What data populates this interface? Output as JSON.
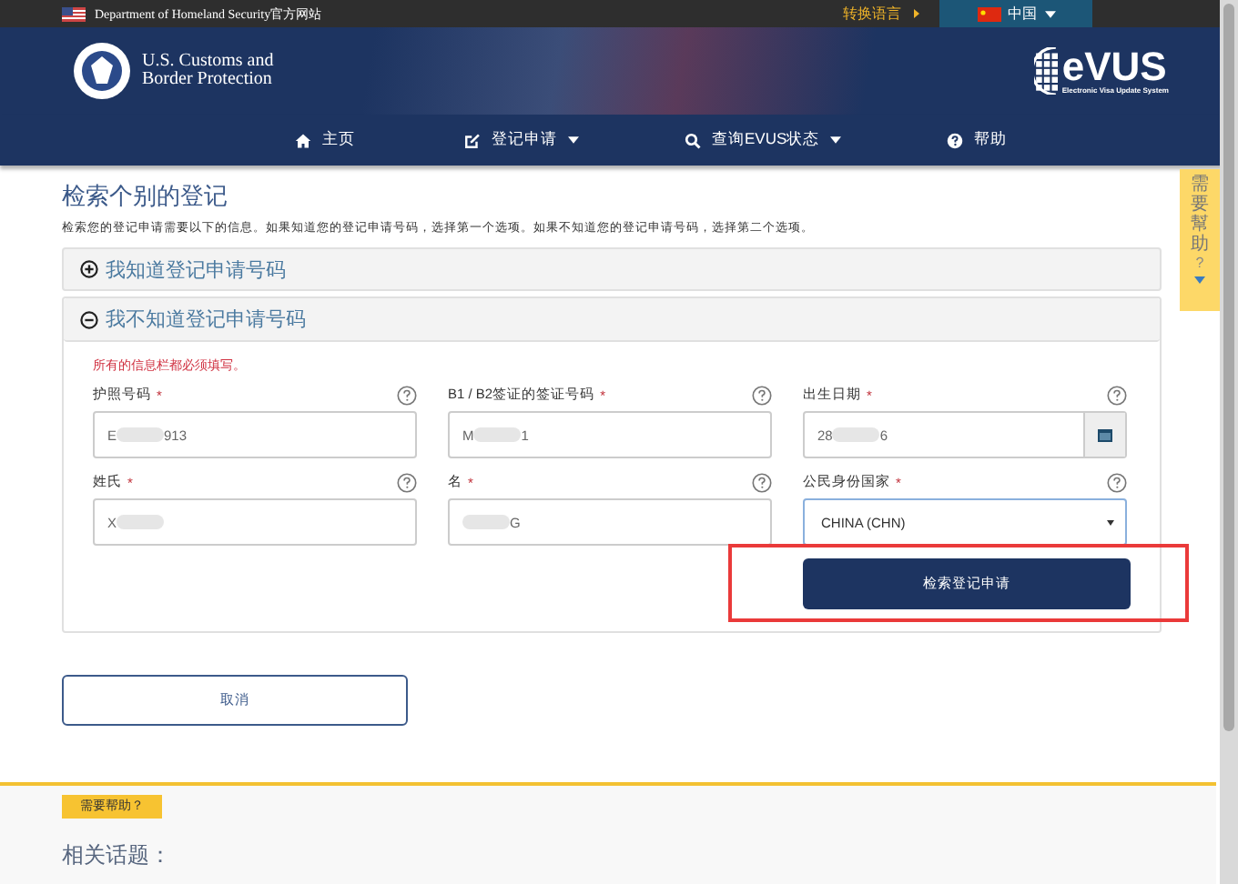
{
  "top_bar": {
    "agency": "Department of Homeland Security官方网站",
    "switch_language": "转换语言",
    "language": "中国"
  },
  "header": {
    "agency_logo_line1": "U.S. Customs and",
    "agency_logo_line2": "Border Protection",
    "brand": "eVUS",
    "brand_subtitle": "Electronic Visa Update System"
  },
  "nav": [
    {
      "label": "主页",
      "dropdown": false
    },
    {
      "label": "登记申请",
      "dropdown": true
    },
    {
      "label": "查询EVUS状态",
      "dropdown": true
    },
    {
      "label": "帮助",
      "dropdown": false
    }
  ],
  "help_tab": {
    "label": "需要幫助",
    "mark": "?"
  },
  "page": {
    "title": "检索个别的登记",
    "intro": "检索您的登记申请需要以下的信息。如果知道您的登记申请号码，选择第一个选项。如果不知道您的登记申请号码，选择第二个选项。"
  },
  "panels": [
    {
      "label": "我知道登记申请号码",
      "expanded": false
    },
    {
      "label": "我不知道登记申请号码",
      "expanded": true
    }
  ],
  "form": {
    "required_note": "所有的信息栏都必须填写。",
    "fields": [
      {
        "kind": "text",
        "label": "护照号码",
        "required_mark": "*",
        "value_start": "E",
        "value_end": "913"
      },
      {
        "kind": "text",
        "label": "B1 / B2签证的签证号码",
        "required_mark": "*",
        "value_start": "M",
        "value_end": "1"
      },
      {
        "kind": "date",
        "label": "出生日期",
        "required_mark": "*",
        "value_start": "28",
        "value_end": "6"
      },
      {
        "kind": "text",
        "label": "姓氏",
        "required_mark": "*",
        "value_start": "X"
      },
      {
        "kind": "text",
        "label": "名",
        "required_mark": "*",
        "value_end": "G"
      },
      {
        "kind": "select",
        "label": "公民身份国家",
        "required_mark": "*",
        "value_start": "CHINA (CHN)"
      }
    ],
    "submit": "检索登记申请"
  },
  "cancel": "取消",
  "footer": {
    "badge": "需要帮助？",
    "heading": "相关话题："
  }
}
